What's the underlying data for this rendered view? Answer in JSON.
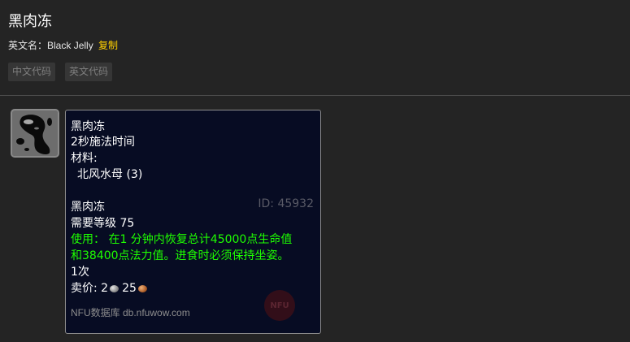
{
  "item": {
    "title": "黑肉冻",
    "en_label": "英文名：",
    "en_name": "Black Jelly",
    "copy_label": "复制"
  },
  "code_buttons": {
    "chinese": "中文代码",
    "english": "英文代码"
  },
  "icon": "black-jelly-item-icon",
  "tooltip": {
    "recipe_name": "黑肉冻",
    "cast_time": "2秒施法时间",
    "materials_label": "材料:",
    "material": "北风水母 (3)",
    "item_name": "黑肉冻",
    "id_text": "ID: 45932",
    "required_level": "需要等级 75",
    "use_line1": "使用：  在1 分钟内恢复总计45000点生命值",
    "use_line2": "和38400点法力值。进食时必须保持坐姿。",
    "charges": "1次",
    "sell_label": "卖价: ",
    "silver": "2",
    "copper": "25",
    "source": "NFU数据库 db.nfuwow.com",
    "logo_text": "NFU"
  },
  "colors": {
    "background": "#242424",
    "tooltip_bg": "#070c23",
    "use_text": "#1eff00",
    "copy_link": "#ffd100"
  }
}
